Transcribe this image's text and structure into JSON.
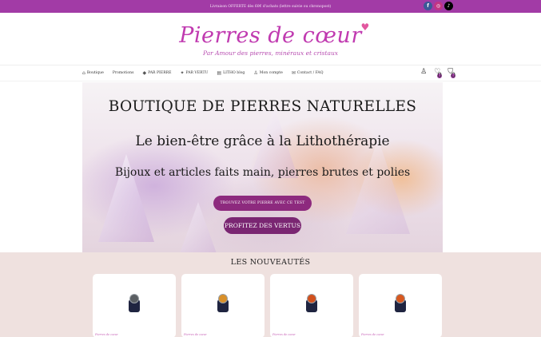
{
  "topbar": {
    "promo_text": "Livraison OFFERTE dès 60€ d'achats (lettre suivie ou chronopost)"
  },
  "social": [
    {
      "name": "facebook-icon",
      "glyph": "f"
    },
    {
      "name": "instagram-icon",
      "glyph": "◎"
    },
    {
      "name": "tiktok-icon",
      "glyph": "♪"
    }
  ],
  "logo": {
    "title": "Pierres de cœur",
    "tagline": "Par Amour des pierres, minéraux et cristaux"
  },
  "nav": {
    "items": [
      {
        "label": "Boutique",
        "icon": "shop-icon",
        "glyph": "⌂"
      },
      {
        "label": "Promotions",
        "icon": "",
        "glyph": ""
      },
      {
        "label": "PAR PIERRE",
        "icon": "gem-icon",
        "glyph": "◆"
      },
      {
        "label": "PAR VERTU",
        "icon": "sparkle-icon",
        "glyph": "✦"
      },
      {
        "label": "LITHO blog",
        "icon": "book-icon",
        "glyph": "▤"
      },
      {
        "label": "Mon compte",
        "icon": "user-icon",
        "glyph": "♙"
      },
      {
        "label": "Contact / FAQ",
        "icon": "mail-icon",
        "glyph": "✉"
      }
    ],
    "wishlist_count": "0",
    "cart_count": "0"
  },
  "hero": {
    "title": "BOUTIQUE DE PIERRES NATURELLES",
    "subtitle": "Le bien-être grâce à la Lithothérapie",
    "tagline": "Bijoux et articles faits main, pierres brutes et polies",
    "quiz_button": "TROUVEZ VOTRE PIERRE AVEC CE TEST",
    "vertus_button": "PROFITEZ DES VERTUS"
  },
  "news": {
    "title": "LES NOUVEAUTÉS",
    "products": [
      {
        "stone_color": "#5b5f63",
        "brand": "Pierres de cœur"
      },
      {
        "stone_color": "#d9902a",
        "brand": "Pierres de cœur"
      },
      {
        "stone_color": "#d2501c",
        "brand": "Pierres de cœur"
      },
      {
        "stone_color": "#d8581f",
        "brand": "Pierres de cœur"
      }
    ]
  },
  "colors": {
    "brand_purple": "#a23ba6",
    "button_purple": "#8d2a7e",
    "news_background": "#efe1df"
  }
}
